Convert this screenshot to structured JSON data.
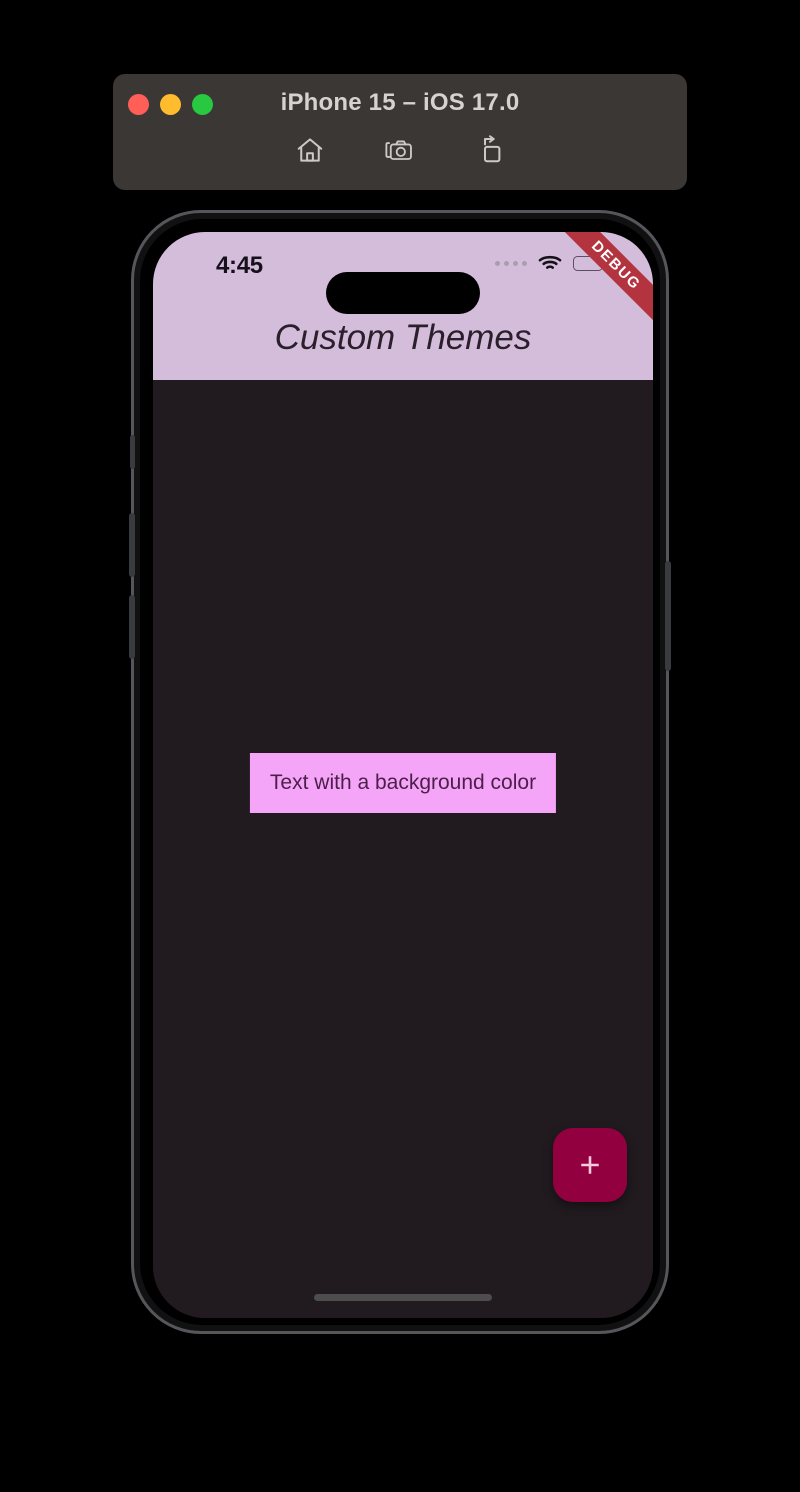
{
  "simulator": {
    "title": "iPhone 15 – iOS 17.0",
    "traffic_lights": [
      {
        "name": "close",
        "color": "#ff5f57"
      },
      {
        "name": "minimize",
        "color": "#febc2e"
      },
      {
        "name": "maximize",
        "color": "#28c840"
      }
    ],
    "toolbar": [
      {
        "icon": "home-icon",
        "label": "Home"
      },
      {
        "icon": "screenshot-camera-icon",
        "label": "Screenshot"
      },
      {
        "icon": "rotate-device-icon",
        "label": "Rotate"
      }
    ],
    "chrome_color": "#3b3735",
    "title_color": "#d6d2cf"
  },
  "device": {
    "frame_color": "#55565a",
    "hardware_buttons": [
      "silence-switch",
      "volume-up",
      "volume-down",
      "power"
    ]
  },
  "status_bar": {
    "time": "4:45",
    "signal_dots": 4,
    "wifi": "wifi-icon",
    "battery": "battery-icon",
    "background": "#d4bdda",
    "text_color": "#15101a"
  },
  "debug_banner": {
    "label": "DEBUG",
    "background": "#b3333f",
    "text_color": "#ffffff"
  },
  "app_bar": {
    "title": "Custom Themes",
    "background": "#d4bdda",
    "title_color": "#2b1f2c"
  },
  "body": {
    "background": "#211b20",
    "text_chip": {
      "label": "Text with a background color",
      "background": "#f5a5f7",
      "text_color": "#4c1f4a"
    },
    "fab": {
      "icon": "plus-icon",
      "background": "#930040",
      "icon_color": "#f4c9dc"
    },
    "home_indicator_color": "#4d4d4d"
  }
}
